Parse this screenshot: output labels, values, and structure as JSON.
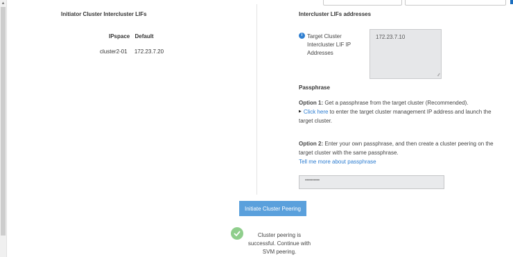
{
  "left": {
    "title": "Initiator Cluster Intercluster LIFs",
    "ipspace_label": "IPspace",
    "ipspace_value": "Default",
    "rows": [
      {
        "node": "cluster2-01",
        "ip": "172.23.7.20"
      }
    ]
  },
  "right": {
    "title": "Intercluster LIFs addresses",
    "info_icon": "i",
    "target_label": "Target Cluster Intercluster LIF IP Addresses",
    "target_value": "172.23.7.10",
    "passphrase_title": "Passphrase",
    "option1_bold": "Option 1:",
    "option1_text": " Get a passphrase from the target cluster (Recommended).",
    "click_here": "Click here",
    "option1_rest": " to enter the target cluster management IP address and launch the target cluster.",
    "option2_bold": "Option 2:",
    "option2_text": " Enter your own passphrase, and then create a cluster peering on the target cluster with the same passphrase.",
    "tell_more": "Tell me more about passphrase",
    "passphrase_value": "••••••••••"
  },
  "actions": {
    "initiate_label": "Initiate Cluster Peering"
  },
  "status": {
    "message": "Cluster peering is successful. Continue with SVM peering."
  },
  "icons": {
    "info": "info-icon",
    "success": "checkmark-icon",
    "caret": "caret-right-icon"
  },
  "colors": {
    "button": "#5aa0dc",
    "link": "#2a7bd0",
    "success": "#8fce8c",
    "info": "#2f7fd1"
  }
}
